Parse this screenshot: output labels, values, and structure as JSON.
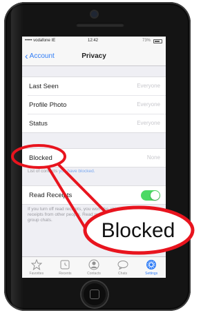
{
  "status_bar": {
    "carrier": "••••• vodafone IE",
    "time": "12:42",
    "battery": "73%",
    "battery_level": 0.73
  },
  "nav": {
    "back_label": "Account",
    "title": "Privacy"
  },
  "visibility_rows": [
    {
      "label": "Last Seen",
      "value": "Everyone"
    },
    {
      "label": "Profile Photo",
      "value": "Everyone"
    },
    {
      "label": "Status",
      "value": "Everyone"
    }
  ],
  "blocked_row": {
    "label": "Blocked",
    "value": "None"
  },
  "blocked_footnote": {
    "text": "List of contacts ",
    "link": "you have blocked."
  },
  "read_receipts": {
    "label": "Read Receipts",
    "enabled": true,
    "footnote": "If you turn off read receipts, you won't be able to see read receipts from other people. Read receipts are always sent for group chats."
  },
  "tab_bar": [
    {
      "label": "Favorites",
      "icon": "star-icon",
      "active": false
    },
    {
      "label": "Recents",
      "icon": "clock-icon",
      "active": false
    },
    {
      "label": "Contacts",
      "icon": "person-icon",
      "active": false
    },
    {
      "label": "Chats",
      "icon": "chat-bubbles-icon",
      "active": false
    },
    {
      "label": "Settings",
      "icon": "gear-icon",
      "active": true
    }
  ],
  "callout": {
    "label": "Blocked",
    "color": "#e8141e"
  },
  "colors": {
    "accent": "#2f7cf6",
    "toggle_on": "#4cd964",
    "phone_body": "#141414"
  }
}
